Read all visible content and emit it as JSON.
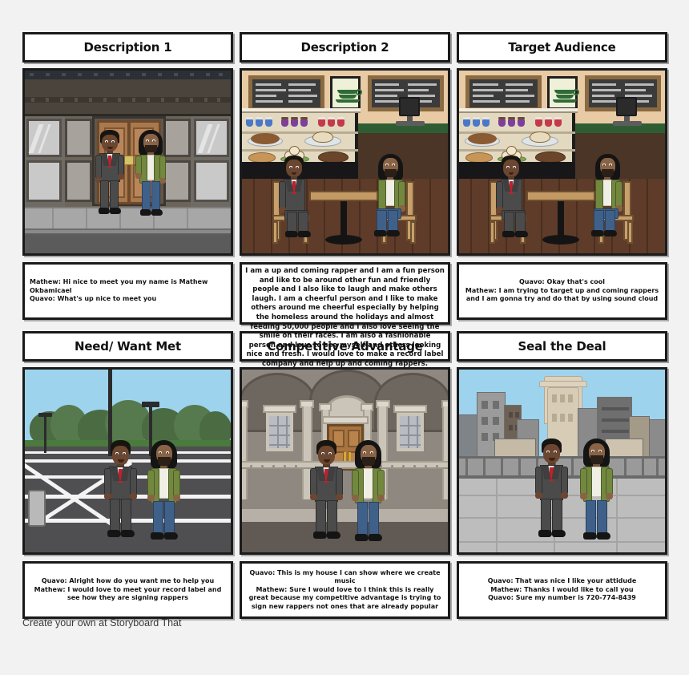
{
  "footer": {
    "text": "Create your own at Storyboard That"
  },
  "panels": [
    {
      "title": "Description 1",
      "scene": "storefront",
      "caption": "Mathew: Hi nice to meet you my name is Mathew Okbamicael\nQuavo: What's up nice to meet you"
    },
    {
      "title": "Description 2",
      "scene": "cafe",
      "caption": "I am a up and coming rapper and I am a fun person and like to be around other fun and friendly people and I also like to laugh and make others laugh. I am a cheerful person and I like to make others around me cheerful especially by helping the homeless around the holidays and almost feeding 50,000 people and I also love seeing the smile on their faces. I am also a fashionable person and love to see myself and others looking nice and fresh.  I would love to make a record label company and help up and coming rappers."
    },
    {
      "title": "Target Audience",
      "scene": "cafe",
      "caption": "Quavo: Okay that's cool\nMathew: I am trying to target up and coming rappers and I am gonna try and do that by using sound cloud"
    },
    {
      "title": "Need/ Want Met",
      "scene": "parking-lot",
      "caption": "Quavo: Alright how do you want me to help you\nMathew: I would love to meet your record label and see how they are signing rappers"
    },
    {
      "title": "Competitive Advantage",
      "scene": "building",
      "caption": "Quavo: This is my house I can show where we create music\nMathew: Sure I would love to I think this is really great because my competitive advantage is trying to sign new rappers not ones that are already popular"
    },
    {
      "title": "Seal the Deal",
      "scene": "rooftop",
      "caption": "Quavo: That was nice I like your attidude\nMathew: Thanks I would like to call you\nQuavo: Sure my number is 720-774-8439"
    }
  ],
  "characters": {
    "suit_man": {
      "name": "Mathew",
      "suit_color": "#4b4b4b",
      "tie_color": "#c2202a"
    },
    "rapper": {
      "name": "Quavo",
      "jacket_color": "#73883f",
      "jeans_color": "#3f6189"
    }
  },
  "colors": {
    "page_background": "#f2f2f2",
    "panel_border": "#1a1a1a",
    "box_fill": "#ffffff",
    "text": "#111111",
    "footer_text": "#3a3a3a"
  }
}
